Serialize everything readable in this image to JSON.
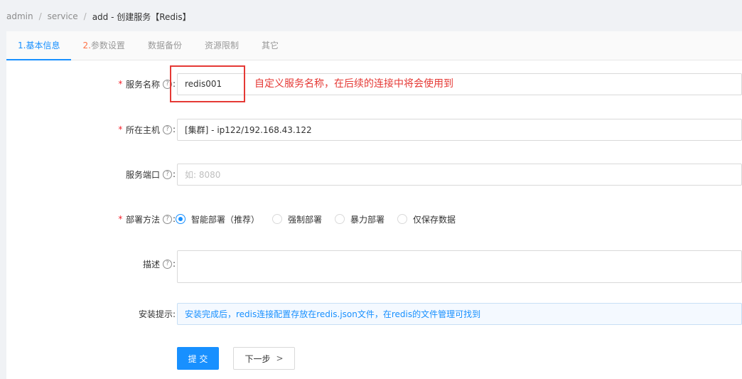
{
  "breadcrumb": {
    "items": [
      "admin",
      "service",
      "add - 创建服务【Redis】"
    ],
    "separator": "/"
  },
  "tabs": [
    {
      "num": "1.",
      "label": "基本信息",
      "active": true
    },
    {
      "num": "2.",
      "label": "参数设置",
      "active": false
    },
    {
      "num": "",
      "label": "数据备份",
      "active": false
    },
    {
      "num": "",
      "label": "资源限制",
      "active": false
    },
    {
      "num": "",
      "label": "其它",
      "active": false
    }
  ],
  "form": {
    "service_name": {
      "label": "服务名称",
      "required_mark": "*",
      "help_icon": "?",
      "colon": ":",
      "value": "redis001"
    },
    "host": {
      "label": "所在主机",
      "required_mark": "*",
      "help_icon": "?",
      "colon": ":",
      "value": "[集群] - ip122/192.168.43.122"
    },
    "port": {
      "label": "服务端口",
      "help_icon": "?",
      "colon": ":",
      "placeholder": "如: 8080"
    },
    "deploy": {
      "label": "部署方法",
      "required_mark": "*",
      "help_icon": "?",
      "colon": ":",
      "options": [
        "智能部署（推荐）",
        "强制部署",
        "暴力部署",
        "仅保存数据"
      ],
      "selected": "智能部署（推荐）"
    },
    "description": {
      "label": "描述",
      "help_icon": "?",
      "colon": ":",
      "value": ""
    },
    "install_hint": {
      "label": "安装提示:",
      "value": "安装完成后，redis连接配置存放在redis.json文件，在redis的文件管理可找到"
    }
  },
  "annotation": "自定义服务名称，在后续的连接中将会使用到",
  "buttons": {
    "submit": "提 交",
    "next": "下一步",
    "next_chevron": ">"
  },
  "colors": {
    "accent": "#1890ff",
    "annotation": "#e53935",
    "tab_number": "#ff7043"
  }
}
